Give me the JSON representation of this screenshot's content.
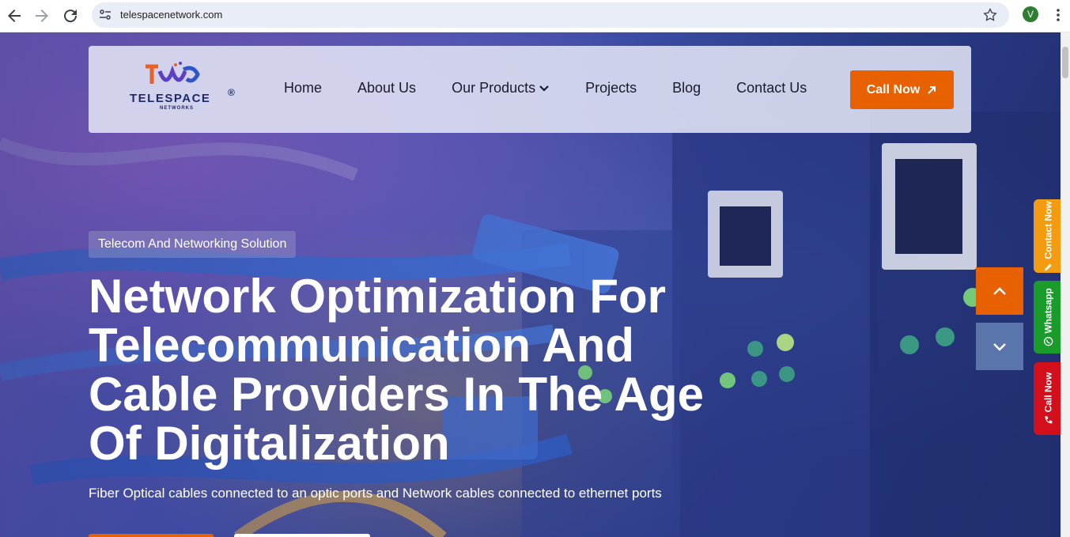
{
  "browser": {
    "url": "telespacenetwork.com",
    "profile_initial": "V"
  },
  "header": {
    "logo_text": "TELESPACE",
    "logo_sub": "NETWORKS",
    "logo_reg": "®",
    "nav": [
      {
        "label": "Home"
      },
      {
        "label": "About Us"
      },
      {
        "label": "Our Products",
        "has_dropdown": true
      },
      {
        "label": "Projects"
      },
      {
        "label": "Blog"
      },
      {
        "label": "Contact Us"
      }
    ],
    "cta_label": "Call Now"
  },
  "hero": {
    "tag": "Telecom And Networking Solution",
    "title": "Network Optimization For Telecommunication And Cable Providers In The Age Of Digitalization",
    "subtitle": "Fiber Optical cables connected to an optic ports and Network cables connected to ethernet ports"
  },
  "side_tabs": {
    "contact": "Contact Now",
    "whatsapp": "Whatsapp",
    "call": "Call Now"
  },
  "colors": {
    "accent": "#e86100",
    "whatsapp": "#1a9c2a",
    "call": "#d40f1c",
    "contact": "#f39c12",
    "brand_navy": "#1d2a6b"
  }
}
